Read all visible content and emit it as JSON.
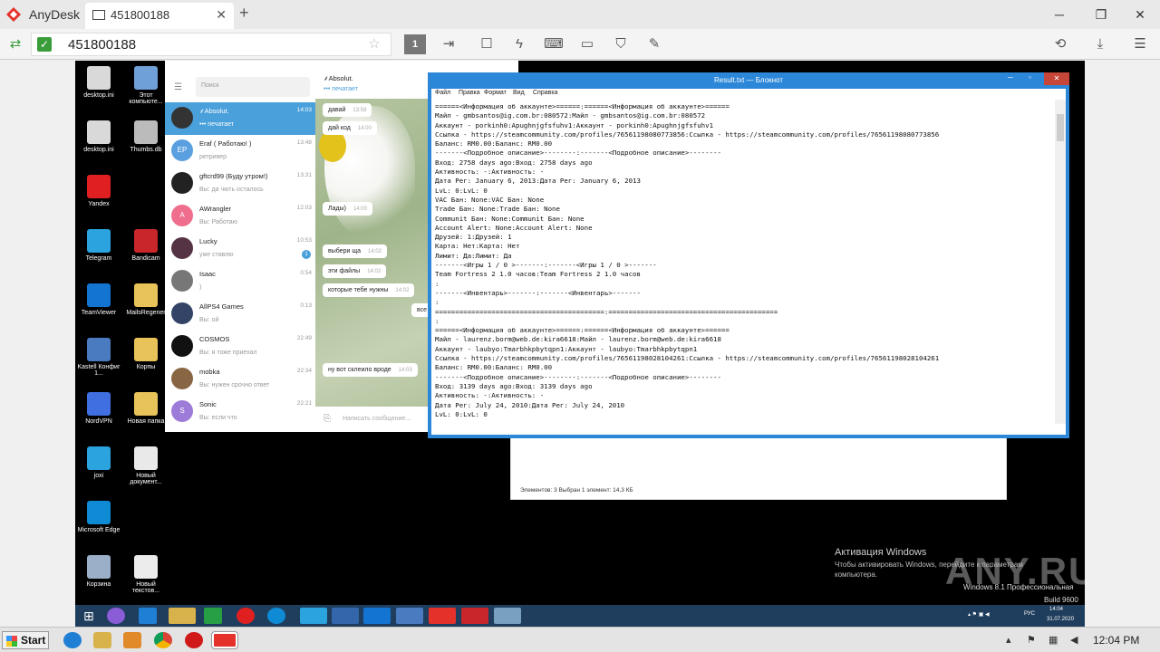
{
  "anydesk": {
    "app_name": "AnyDesk",
    "tab_label": "451800188",
    "address": "451800188",
    "colors": {
      "brand": "#e4322b",
      "connected": "#3a9d3a"
    }
  },
  "desktop": {
    "icons": [
      {
        "label": "desktop.ini",
        "color": "#d9d9d9"
      },
      {
        "label": "Этот компьюте...",
        "color": "#6fa0d8"
      },
      {
        "label": "desktop.ini",
        "color": "#d9d9d9"
      },
      {
        "label": "Thumbs.db",
        "color": "#bbbbbb"
      },
      {
        "label": "Yandex",
        "color": "#e02020"
      },
      {
        "label": "Telegram",
        "color": "#2aa3df"
      },
      {
        "label": "Bandicam",
        "color": "#c8262b"
      },
      {
        "label": "TeamViewer",
        "color": "#1374d1"
      },
      {
        "label": "MailsRegener",
        "color": "#e8c35a"
      },
      {
        "label": "Kastell Конфиг 1...",
        "color": "#4a7bc0"
      },
      {
        "label": "Корпы",
        "color": "#e8c35a"
      },
      {
        "label": "NordVPN",
        "color": "#3f6fe0"
      },
      {
        "label": "Новая папка",
        "color": "#e8c35a"
      },
      {
        "label": "joxi",
        "color": "#2aa3df"
      },
      {
        "label": "Новый документ...",
        "color": "#e9e9e9"
      },
      {
        "label": "Microsoft Edge",
        "color": "#0f8bd6"
      },
      {
        "label": "Корзина",
        "color": "#9bb0c8"
      },
      {
        "label": "Новый текстов...",
        "color": "#ececec"
      }
    ]
  },
  "telegram": {
    "search_placeholder": "Поиск",
    "chats": [
      {
        "name": "⸙Absolut.",
        "preview": "••• печатает",
        "time": "14:03",
        "active": true,
        "avatar": "",
        "color": "#333333"
      },
      {
        "name": "Eraf ( Работаю! )",
        "preview": "ретривер",
        "time": "13:48",
        "avatar": "EP",
        "color": "#5aa0e0"
      },
      {
        "name": "gftcrd99 (Буду утром!)",
        "preview": "Вы: да чють осталось",
        "time": "13:31",
        "avatar": "",
        "color": "#222222"
      },
      {
        "name": "AWrangler",
        "preview": "Вы: Работаю",
        "time": "12:03",
        "avatar": "A",
        "color": "#ef6d8d"
      },
      {
        "name": "Lucky",
        "preview": "уже ставлю",
        "time": "10:53",
        "avatar": "",
        "color": "#553344",
        "badge": "1"
      },
      {
        "name": "Isaac",
        "preview": ")",
        "time": "0:54",
        "avatar": "",
        "color": "#777777"
      },
      {
        "name": "AllPS4 Games",
        "preview": "Вы: ой",
        "time": "0:13",
        "avatar": "",
        "color": "#334466"
      },
      {
        "name": "COSMOS",
        "preview": "Вы: я тоже приехал",
        "time": "22:49",
        "avatar": "",
        "color": "#111111"
      },
      {
        "name": "mobka",
        "preview": "Вы: нужен срочно ответ",
        "time": "22:34",
        "avatar": "",
        "color": "#886644"
      },
      {
        "name": "Sonic",
        "preview": "Вы: если что",
        "time": "22:21",
        "avatar": "S",
        "color": "#9d7bd8"
      }
    ],
    "conversation": {
      "title": "⸙Absolut.",
      "status": "••• печатает",
      "messages": [
        {
          "text": "давай",
          "time": "13:58"
        },
        {
          "text": "дай код",
          "time": "14:00"
        },
        {
          "text": "Лады)",
          "time": "14:00"
        },
        {
          "text": "выбери ща",
          "time": "14:02"
        },
        {
          "text": "эти файлы",
          "time": "14:02"
        },
        {
          "text": "которые тебе нужны",
          "time": "14:02"
        },
        {
          "text": "все",
          "time": ""
        },
        {
          "text": "ну вот склеило вроде",
          "time": "14:03"
        }
      ],
      "input_placeholder": "Написать сообщение..."
    }
  },
  "explorer": {
    "status": "Элементов: 3     Выбран 1 элемент: 14,3 КБ"
  },
  "notepad": {
    "title": "Result.txt — Блокнот",
    "menu": [
      "Файл",
      "Правка",
      "Формат",
      "Вид",
      "Справка"
    ],
    "text": "======<Информация об аккаунте>======:======<Информация об аккаунте>======\nМайл - gmbsantos@ig.com.br:080572:Майл - gmbsantos@ig.com.br:080572\nАккаунт - porkinh0:Apughnjgfsfuhv1:Аккаунт - porkinh0:Apughnjgfsfuhv1\nСсылка - https://steamcommunity.com/profiles/76561198080773856:Ссылка - https://steamcommunity.com/profiles/76561198080773856\nБаланс: RM0.00:Баланс: RM0.00\n-------<Подробное описание>--------:-------<Подробное описание>--------\nВход: 2758 days ago:Вход: 2758 days ago\nАктивность: -:Активность: -\nДата Рег: January 6, 2013:Дата Рег: January 6, 2013\nLvL: 0:LvL: 0\nVAC Бан: None:VAC Бан: None\nTrade Бан: None:Trade Бан: None\nCommunit Бан: None:Communit Бан: None\nAccount Alert: None:Account Alert: None\nДрузей: 1:Друзей: 1\nКарта: Нет:Карта: Нет\nЛимит: Да:Лимит: Да\n-------<Игры 1 / 0 >-------:-------<Игры 1 / 0 >-------\nTeam Fortress 2 1.0 часов:Team Fortress 2 1.0 часов\n:\n-------<Инвентарь>-------:-------<Инвентарь>-------\n:\n==========================================:==========================================\n:\n======<Информация об аккаунте>======:======<Информация об аккаунте>======\nМайл - laurenz.borm@web.de:kira6618:Майл - laurenz.borm@web.de:kira6618\nАккаунт - laubyo:Tmarbhkpbytqpn1:Аккаунт - laubyo:Tmarbhkpbytqpn1\nСсылка - https://steamcommunity.com/profiles/76561198028104261:Ссылка - https://steamcommunity.com/profiles/76561198028104261\nБаланс: RM0.00:Баланс: RM0.00\n-------<Подробное описание>--------:-------<Подробное описание>--------\nВход: 3139 days ago:Вход: 3139 days ago\nАктивность: -:Активность: -\nДата Рег: July 24, 2010:Дата Рег: July 24, 2010\nLvL: 0:LvL: 0"
  },
  "windows_notice": {
    "title": "Активация Windows",
    "line1": "Чтобы активировать Windows, перейдите к параметрам",
    "line2": "компьютера.",
    "version": "Windows 8.1 Профессиональная",
    "build": "Build 9600",
    "watermark": "ANY.RUN"
  },
  "remote_taskbar": {
    "tray_lang": "РУС",
    "tray_time": "14:04",
    "tray_date": "31.07.2020"
  },
  "host_taskbar": {
    "start_label": "Start",
    "clock": "12:04 PM"
  }
}
